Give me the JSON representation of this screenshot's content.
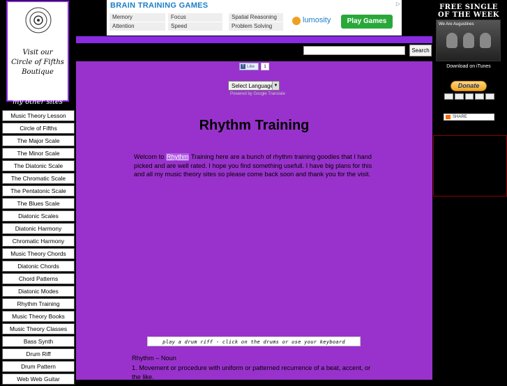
{
  "boutique": {
    "caption_lines": [
      "Visit our",
      "Circle of Fifths",
      "Boutique"
    ]
  },
  "sidebar": {
    "heading": "my other sites",
    "items": [
      "Music Theory Lesson",
      "Circle of Fifths",
      "The Major Scale",
      "The Minor Scale",
      "The Diatonic Scale",
      "The Chromatic Scale",
      "The Pentatonic Scale",
      "The Blues Scale",
      "Diatonic Scales",
      "Diatonic Harmony",
      "Chromatic Harmony",
      "Music Theory Chords",
      "Diatonic Chords",
      "Chord Patterns",
      "Diatonic Modes",
      "Rhythm Training",
      "Music Theory Books",
      "Music Theory Classes",
      "Bass Synth",
      "Drum Riff",
      "Drum Pattern",
      "Web Web Guitar"
    ]
  },
  "ad": {
    "title": "BRAIN TRAINING GAMES",
    "cells": [
      "Memory",
      "Focus",
      "Spatial Reasoning",
      "Attention",
      "Speed",
      "Problem Solving"
    ],
    "brand": "lumosity",
    "button": "Play Games"
  },
  "search": {
    "value": "",
    "button": "Search"
  },
  "social": {
    "like_label": "Like",
    "like_count": "1"
  },
  "translate": {
    "select_label": "Select Language",
    "powered_by": "Powered by Google Translate"
  },
  "main": {
    "title": "Rhythm Training",
    "intro_before": "Welcom to ",
    "intro_link": "Rhythm",
    "intro_after": " Training here are a bunch of rhythm training goodies that I hand picked and are well rated. I hope you find something usefull. I have big plans for this and all my music theory sites so please come back soon and thank you for the visit.",
    "drum_banner": "play a drum riff - click on the drums or use your keyboard",
    "definition_word": "Rhythm – Noun",
    "definition_text": "1. Movement or procedure with uniform or patterned recurrence of a beat, accent, or the like."
  },
  "right": {
    "single_title_lines": [
      "FREE SINGLE",
      "OF THE WEEK"
    ],
    "band_name": "We Are Augustines",
    "itunes": "Download on iTunes",
    "donate": "Donate",
    "share": "SHARE"
  },
  "colors": {
    "purple_main": "#9932cc",
    "purple_bar": "#8a2be2",
    "background": "#000000"
  }
}
